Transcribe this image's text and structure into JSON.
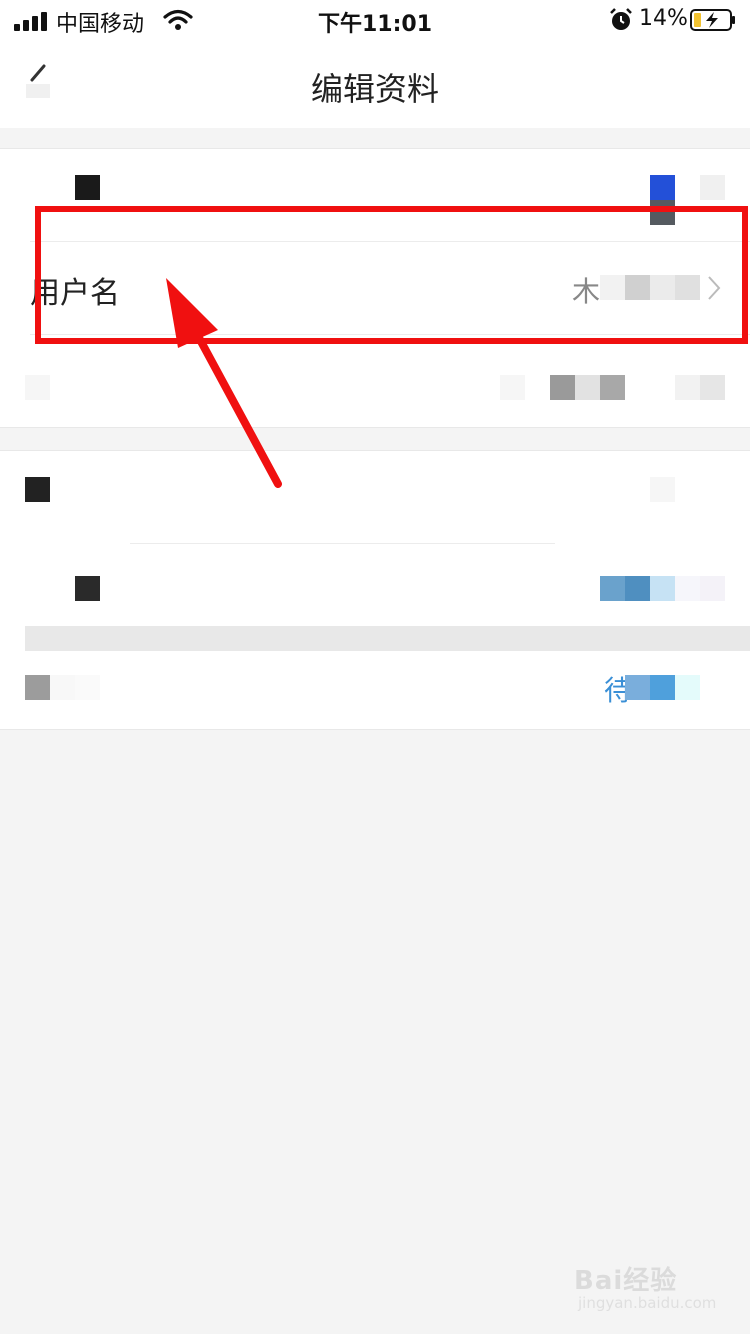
{
  "status_bar": {
    "carrier": "中国移动",
    "time": "下午11:01",
    "battery_percent": "14%"
  },
  "nav": {
    "title": "编辑资料"
  },
  "group1": {
    "rows": [
      {
        "label": "",
        "value": ""
      },
      {
        "label": "用户名",
        "value": "木"
      },
      {
        "label": "",
        "value": ""
      }
    ]
  },
  "group2": {
    "rows": [
      {
        "label": "",
        "value": ""
      },
      {
        "label": "",
        "value": ""
      },
      {
        "label": "",
        "value": "待"
      }
    ]
  },
  "annotation": {
    "highlight_color": "#f01010"
  },
  "watermark": {
    "brand": "Bai经验",
    "url": "jingyan.baidu.com"
  },
  "colors": {
    "accent_link": "#3a8fd6",
    "background": "#f4f4f4"
  }
}
